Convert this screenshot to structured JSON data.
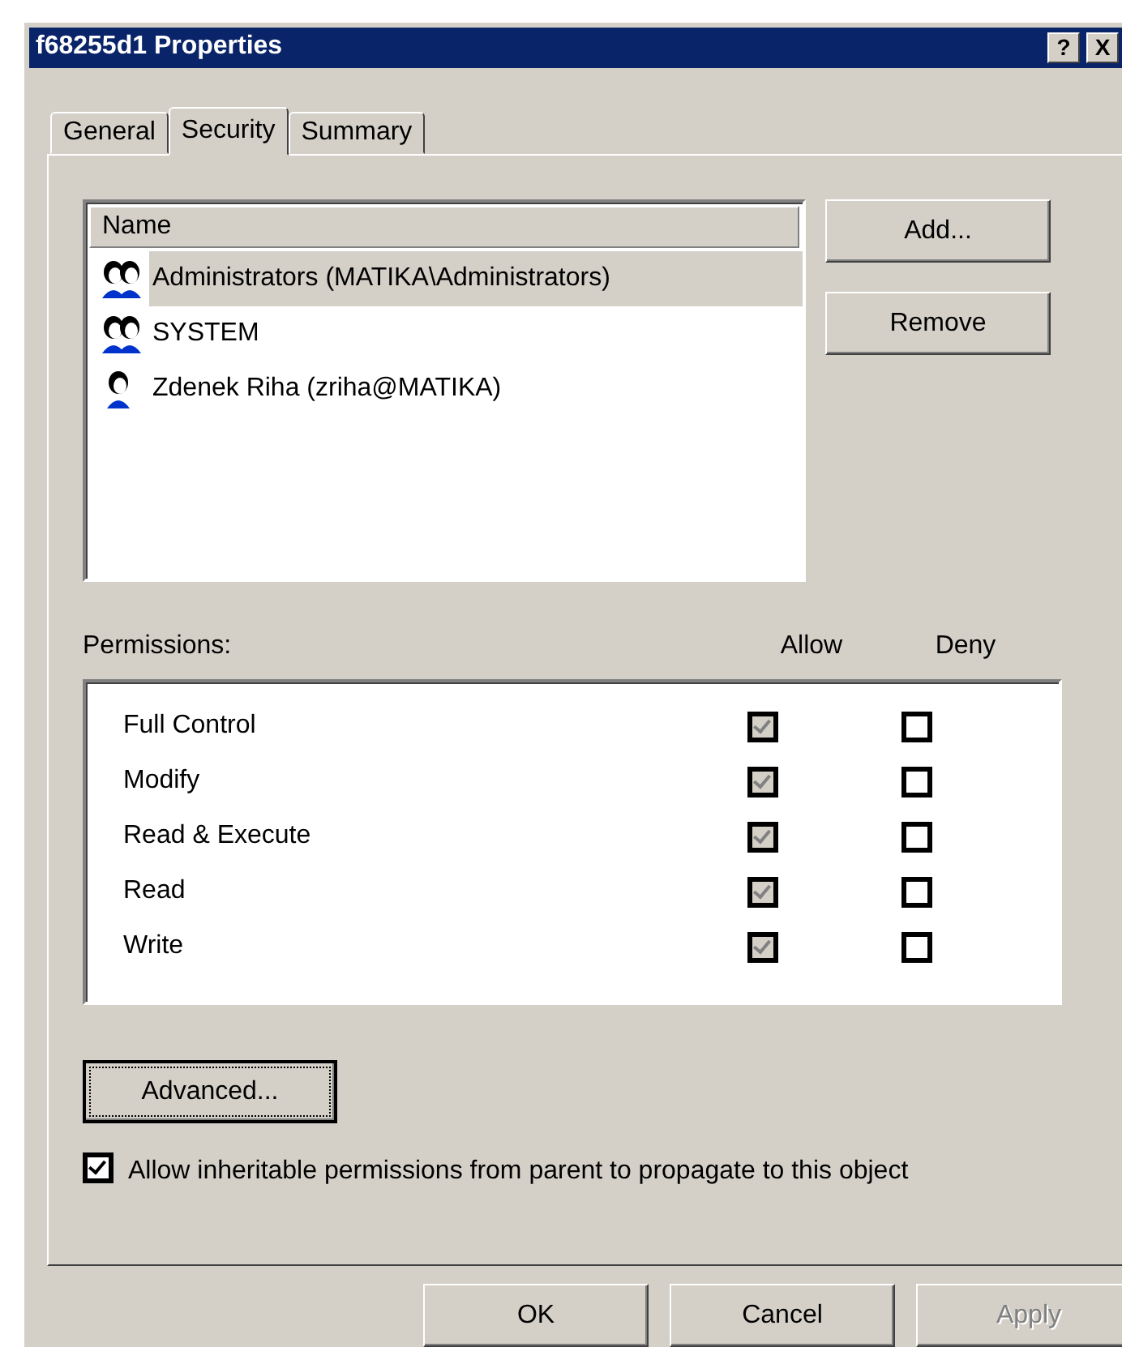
{
  "window": {
    "title": "f68255d1 Properties",
    "title_buttons": [
      "?",
      "X"
    ]
  },
  "tabs": [
    {
      "label": "General",
      "selected": false
    },
    {
      "label": "Security",
      "selected": true
    },
    {
      "label": "Summary",
      "selected": false
    }
  ],
  "users": {
    "header": "Name",
    "items": [
      {
        "name": "Administrators (MATIKA\\Administrators)",
        "kind": "group",
        "selected": true
      },
      {
        "name": "SYSTEM",
        "kind": "group",
        "selected": false
      },
      {
        "name": "Zdenek Riha (zriha@MATIKA)",
        "kind": "user",
        "selected": false
      }
    ]
  },
  "user_buttons": [
    {
      "label": "Add..."
    },
    {
      "label": "Remove"
    }
  ],
  "permissions": {
    "label": "Permissions:",
    "allow_header": "Allow",
    "deny_header": "Deny",
    "rows": [
      {
        "name": "Full Control",
        "allow": true,
        "allow_disabled": true,
        "deny": false
      },
      {
        "name": "Modify",
        "allow": true,
        "allow_disabled": true,
        "deny": false
      },
      {
        "name": "Read & Execute",
        "allow": true,
        "allow_disabled": true,
        "deny": false
      },
      {
        "name": "Read",
        "allow": true,
        "allow_disabled": true,
        "deny": false
      },
      {
        "name": "Write",
        "allow": true,
        "allow_disabled": true,
        "deny": false
      }
    ]
  },
  "advanced_button": {
    "label": "Advanced...",
    "focused": true
  },
  "inherit": {
    "label": "Allow inheritable permissions from parent to propagate to this object",
    "checked": true
  },
  "dialog_buttons": [
    {
      "label": "OK",
      "disabled": false
    },
    {
      "label": "Cancel",
      "disabled": false
    },
    {
      "label": "Apply",
      "disabled": true
    }
  ]
}
